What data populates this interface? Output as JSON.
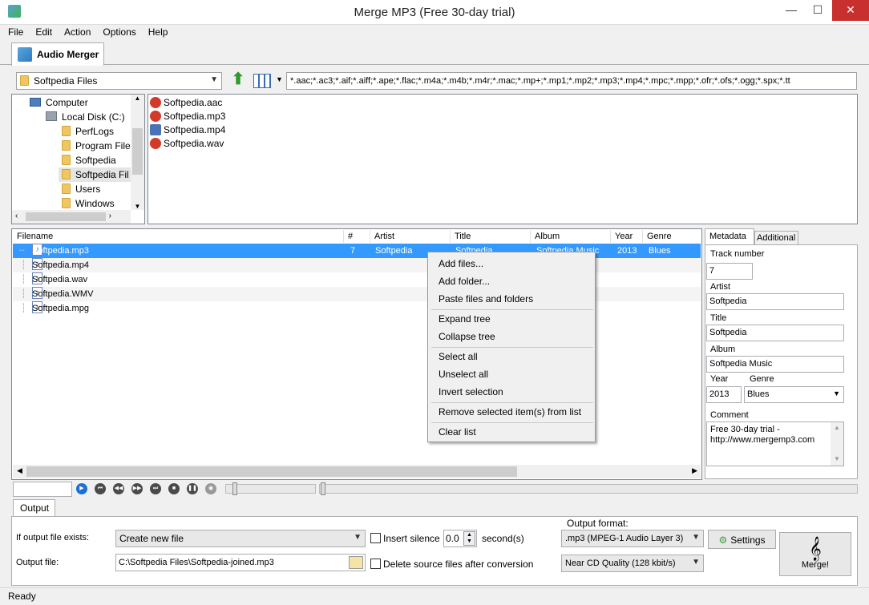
{
  "window": {
    "title": "Merge MP3 (Free 30-day trial)",
    "minimize": "—",
    "maximize": "☐",
    "close": "✕"
  },
  "menu": [
    "File",
    "Edit",
    "Action",
    "Options",
    "Help"
  ],
  "tab": {
    "label": "Audio Merger"
  },
  "toolbar": {
    "folder": "Softpedia Files",
    "filter": "*.aac;*.ac3;*.aif;*.aiff;*.ape;*.flac;*.m4a;*.m4b;*.m4r;*.mac;*.mp+;*.mp1;*.mp2;*.mp3;*.mp4;*.mpc;*.mpp;*.ofr;*.ofs;*.ogg;*.spx;*.tt"
  },
  "tree": [
    "Computer",
    "Local Disk (C:)",
    "PerfLogs",
    "Program File",
    "Softpedia",
    "Softpedia Fil",
    "Users",
    "Windows"
  ],
  "browser_files": [
    "Softpedia.aac",
    "Softpedia.mp3",
    "Softpedia.mp4",
    "Softpedia.wav"
  ],
  "list": {
    "columns": [
      "Filename",
      "#",
      "Artist",
      "Title",
      "Album",
      "Year",
      "Genre"
    ],
    "rows": [
      {
        "filename": "Softpedia.mp3",
        "num": "7",
        "artist": "Softpedia",
        "title": "Softpedia",
        "album": "Softpedia Music",
        "year": "2013",
        "genre": "Blues"
      },
      {
        "filename": "Softpedia.mp4",
        "num": "",
        "artist": "",
        "title": "",
        "album": "",
        "year": "",
        "genre": ""
      },
      {
        "filename": "Softpedia.wav",
        "num": "",
        "artist": "",
        "title": "",
        "album": "",
        "year": "",
        "genre": ""
      },
      {
        "filename": "Softpedia.WMV",
        "num": "",
        "artist": "",
        "title": "",
        "album": "",
        "year": "",
        "genre": ""
      },
      {
        "filename": "Softpedia.mpg",
        "num": "",
        "artist": "",
        "title": "",
        "album": "",
        "year": "",
        "genre": ""
      }
    ]
  },
  "context_menu": [
    "Add files...",
    "Add folder...",
    "Paste files and folders",
    "Expand tree",
    "Collapse tree",
    "Select all",
    "Unselect all",
    "Invert selection",
    "Remove selected item(s)  from list",
    "Clear list"
  ],
  "metadata": {
    "tabs": [
      "Metadata",
      "Additional"
    ],
    "track_label": "Track number",
    "track": "7",
    "artist_label": "Artist",
    "artist": "Softpedia",
    "title_label": "Title",
    "title": "Softpedia",
    "album_label": "Album",
    "album": "Softpedia Music",
    "year_label": "Year",
    "year": "2013",
    "genre_label": "Genre",
    "genre": "Blues",
    "comment_label": "Comment",
    "comment1": "Free 30-day trial -",
    "comment2": "http://www.mergemp3.com"
  },
  "output": {
    "tab": "Output",
    "if_exists_label": "If output file exists:",
    "if_exists": "Create new file",
    "insert_silence": "Insert silence",
    "silence_value": "0.0",
    "seconds": "second(s)",
    "format_label": "Output format:",
    "format": ".mp3 (MPEG-1 Audio Layer 3)",
    "settings": "Settings",
    "file_label": "Output file:",
    "file": "C:\\Softpedia Files\\Softpedia-joined.mp3",
    "delete_source": "Delete source files after conversion",
    "quality": "Near CD Quality (128 kbit/s)",
    "merge": "Merge!"
  },
  "status": "Ready"
}
